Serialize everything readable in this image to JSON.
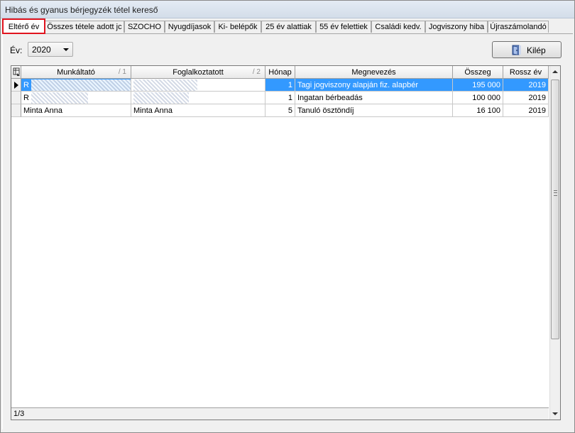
{
  "window": {
    "title": "Hibás és gyanus bérjegyzék tétel kereső"
  },
  "tabs": [
    {
      "label": "Eltérő év",
      "active": true
    },
    {
      "label": "Összes tétele adott jc",
      "active": false
    },
    {
      "label": "SZOCHO",
      "active": false
    },
    {
      "label": "Nyugdíjasok",
      "active": false
    },
    {
      "label": "Ki- belépők",
      "active": false
    },
    {
      "label": "25 év alattiak",
      "active": false
    },
    {
      "label": "55 év felettiek",
      "active": false
    },
    {
      "label": "Családi kedv.",
      "active": false
    },
    {
      "label": "Jogviszony hiba",
      "active": false
    },
    {
      "label": "Újraszámolandó",
      "active": false
    }
  ],
  "filter": {
    "year_label": "Év:",
    "year_value": "2020"
  },
  "exit_button": {
    "label": "Kilép",
    "icon": "door-exit-icon"
  },
  "grid": {
    "columns": [
      {
        "label": "Munkáltató",
        "sort": "/ 1"
      },
      {
        "label": "Foglalkoztatott",
        "sort": "/ 2"
      },
      {
        "label": "Hónap",
        "sort": ""
      },
      {
        "label": "Megnevezés",
        "sort": ""
      },
      {
        "label": "Összeg",
        "sort": ""
      },
      {
        "label": "Rossz év",
        "sort": ""
      }
    ],
    "rows": [
      {
        "employer": "R",
        "employee": "",
        "month": "1",
        "name": "Tagi jogviszony alapján fiz. alapbér",
        "amount": "195 000",
        "year": "2019",
        "selected": true
      },
      {
        "employer": "R",
        "employee": "",
        "month": "1",
        "name": "Ingatan bérbeadás",
        "amount": "100 000",
        "year": "2019",
        "selected": false
      },
      {
        "employer": "Minta Anna",
        "employee": "Minta Anna",
        "month": "5",
        "name": "Tanuló ösztöndíj",
        "amount": "16 100",
        "year": "2019",
        "selected": false
      }
    ],
    "record_counter": "1/3"
  },
  "colors": {
    "selection": "#3399ff",
    "active_tab_outline": "#e0141e"
  }
}
